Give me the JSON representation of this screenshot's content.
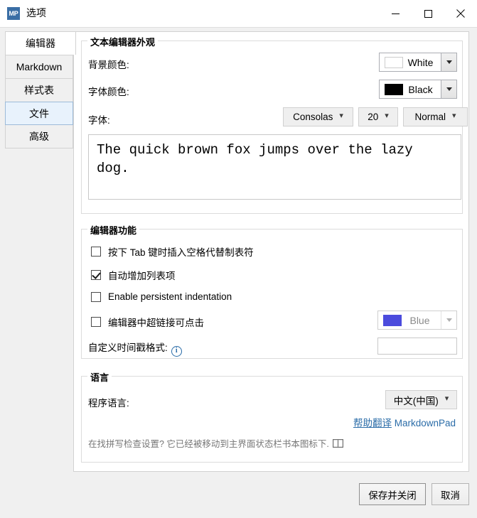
{
  "window": {
    "app_icon_text": "MP",
    "title": "选项",
    "controls": {
      "minimize": "minimize-icon",
      "maximize": "maximize-icon",
      "close": "close-icon"
    }
  },
  "tabs": [
    {
      "label": "编辑器",
      "state": "active"
    },
    {
      "label": "Markdown",
      "state": "normal"
    },
    {
      "label": "样式表",
      "state": "normal"
    },
    {
      "label": "文件",
      "state": "hover"
    },
    {
      "label": "高级",
      "state": "normal"
    }
  ],
  "appearance": {
    "group_title": "文本编辑器外观",
    "background_color": {
      "label": "背景颜色:",
      "value": "White",
      "swatch_hex": "#ffffff"
    },
    "font_color": {
      "label": "字体颜色:",
      "value": "Black",
      "swatch_hex": "#000000"
    },
    "font": {
      "label": "字体:",
      "family": "Consolas",
      "size": "20",
      "style": "Normal"
    },
    "preview_text": "The quick brown fox jumps over the lazy dog."
  },
  "editor_features": {
    "group_title": "编辑器功能",
    "checkboxes": [
      {
        "label": "按下 Tab 键时插入空格代替制表符",
        "checked": false
      },
      {
        "label": "自动增加列表项",
        "checked": true
      },
      {
        "label": "Enable persistent indentation",
        "checked": false
      },
      {
        "label": "编辑器中超链接可点击",
        "checked": false
      }
    ],
    "link_color": {
      "value": "Blue",
      "swatch_hex": "#4b4bdd",
      "disabled": true
    },
    "timestamp": {
      "label": "自定义时间戳格式:",
      "info_glyph": "i",
      "value": "",
      "placeholder": ""
    }
  },
  "language": {
    "group_title": "语言",
    "program_language": {
      "label": "程序语言:",
      "value": "中文(中国)"
    },
    "translate_link": {
      "underlined": "帮助翻译",
      "plain": " MarkdownPad",
      "color_hex": "#2a6ca8"
    },
    "hint": "在找拼写检查设置? 它已经被移动到主界面状态栏书本图标下."
  },
  "footer": {
    "save_label": "保存并关闭",
    "cancel_label": "取消"
  }
}
